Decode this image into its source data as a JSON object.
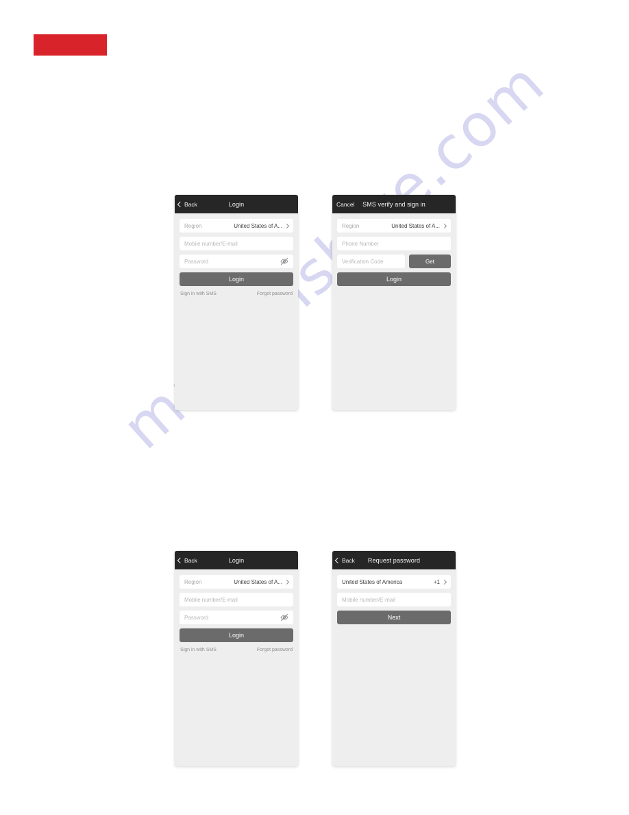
{
  "page": {
    "watermark": "manualshive.com",
    "brand_color": "#d8232a"
  },
  "screens": [
    {
      "id": "login-top",
      "nav": {
        "back_label": "Back",
        "title": "Login"
      },
      "region": {
        "label": "Region",
        "value": "United States of A..."
      },
      "account_placeholder": "Mobile number/E-mail",
      "password_placeholder": "Password",
      "primary_button": "Login",
      "link_left": "Sign in with SMS",
      "link_right": "Forgot password"
    },
    {
      "id": "sms-verify",
      "nav": {
        "back_label": "Cancel",
        "title": "SMS verify and sign in"
      },
      "region": {
        "label": "Region",
        "value": "United States of A..."
      },
      "phone_placeholder": "Phone Number",
      "code_placeholder": "Verification Code",
      "get_button": "Get",
      "primary_button": "Login"
    },
    {
      "id": "login-bottom",
      "nav": {
        "back_label": "Back",
        "title": "Login"
      },
      "region": {
        "label": "Region",
        "value": "United States of A..."
      },
      "account_placeholder": "Mobile number/E-mail",
      "password_placeholder": "Password",
      "primary_button": "Login",
      "link_left": "Sign in with SMS",
      "link_right": "Forgot password"
    },
    {
      "id": "request-password",
      "nav": {
        "back_label": "Back",
        "title": "Request password"
      },
      "country": {
        "name": "United States of America",
        "code": "+1"
      },
      "account_placeholder": "Mobile number/E-mail",
      "primary_button": "Next"
    }
  ]
}
